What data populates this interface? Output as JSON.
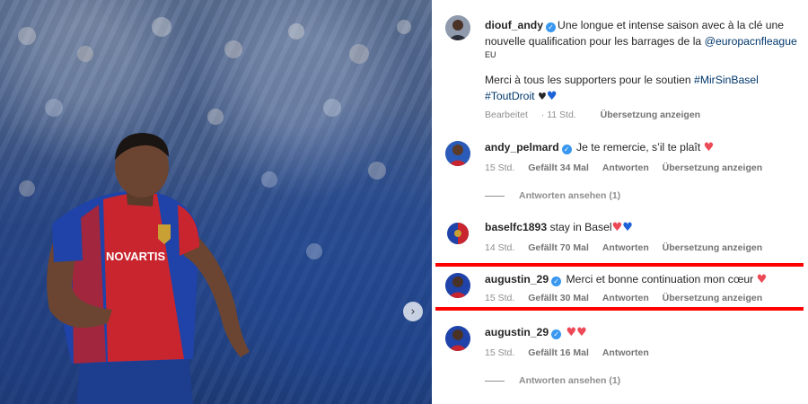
{
  "post": {
    "username": "diouf_andy",
    "caption_line1": "Une longue et intense saison avec à la clé une nouvelle qualification pour les barrages de la ",
    "caption_mention": "@europacnfleague",
    "caption_eu": "EU",
    "caption_line2": "Merci à tous les supporters pour le soutien ",
    "hashtag1": "#MirSinBasel",
    "hashtag2": "#ToutDroit",
    "meta_edited": "Bearbeitet",
    "meta_time": "11 Std.",
    "meta_translate": "Übersetzung anzeigen"
  },
  "comments": [
    {
      "username": "andy_pelmard",
      "verified": true,
      "text": "Je te remercie, s’il te plaît",
      "time": "15 Std.",
      "likes": "Gefällt 34 Mal",
      "reply": "Antworten",
      "translate": "Übersetzung anzeigen",
      "view_replies": "Antworten ansehen (1)"
    },
    {
      "username": "baselfc1893",
      "verified": false,
      "text": "stay in Basel",
      "time": "14 Std.",
      "likes": "Gefällt 70 Mal",
      "reply": "Antworten",
      "translate": "Übersetzung anzeigen"
    },
    {
      "username": "augustin_29",
      "verified": true,
      "text": "Merci et bonne continuation mon cœur",
      "time": "15 Std.",
      "likes": "Gefällt 30 Mal",
      "reply": "Antworten",
      "translate": "Übersetzung anzeigen"
    },
    {
      "username": "augustin_29",
      "verified": true,
      "text": "",
      "time": "15 Std.",
      "likes": "Gefällt 16 Mal",
      "reply": "Antworten",
      "view_replies": "Antworten ansehen (1)"
    }
  ],
  "media": {
    "jersey_sponsor": "NOVARTIS",
    "next_icon": "chevron-right-icon"
  },
  "colors": {
    "verified": "#3897f0",
    "link": "#00376b",
    "heart_red": "#ed4956",
    "heart_blue": "#1c63d8",
    "highlight_line": "#ff0000"
  }
}
